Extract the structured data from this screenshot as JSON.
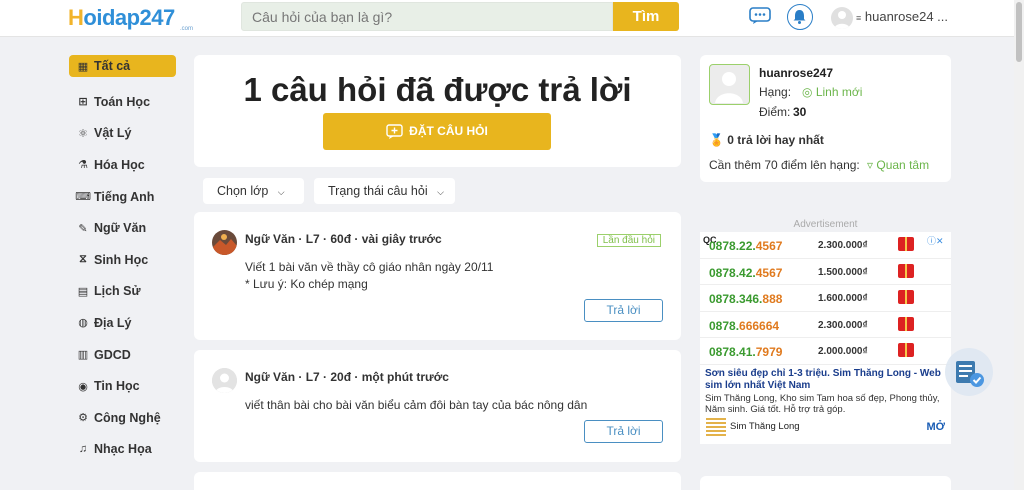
{
  "header": {
    "logo_h": "H",
    "logo_rest": "oidap247",
    "logo_sub": ".com",
    "search_placeholder": "Câu hỏi của bạn là gì?",
    "search_button": "Tìm",
    "user_name": "huanrose24 ..."
  },
  "sidebar": {
    "items": [
      {
        "label": "Tất cả",
        "icon": "grid-icon",
        "glyph": "▦"
      },
      {
        "label": "Toán Học",
        "icon": "calculator-icon",
        "glyph": "⊞"
      },
      {
        "label": "Vật Lý",
        "icon": "atom-icon",
        "glyph": "⚛"
      },
      {
        "label": "Hóa Học",
        "icon": "flask-icon",
        "glyph": "⚗"
      },
      {
        "label": "Tiếng Anh",
        "icon": "language-icon",
        "glyph": "⌨"
      },
      {
        "label": "Ngữ Văn",
        "icon": "pen-icon",
        "glyph": "✎"
      },
      {
        "label": "Sinh Học",
        "icon": "dna-icon",
        "glyph": "⧖"
      },
      {
        "label": "Lịch Sử",
        "icon": "scroll-icon",
        "glyph": "▤"
      },
      {
        "label": "Địa Lý",
        "icon": "globe-icon",
        "glyph": "◍"
      },
      {
        "label": "GDCD",
        "icon": "book-icon",
        "glyph": "▥"
      },
      {
        "label": "Tin Học",
        "icon": "computer-icon",
        "glyph": "◉"
      },
      {
        "label": "Công Nghệ",
        "icon": "gear-icon",
        "glyph": "⚙"
      },
      {
        "label": "Nhạc Họa",
        "icon": "music-icon",
        "glyph": "♫"
      }
    ]
  },
  "hero": {
    "title": "1 câu hỏi đã được trả lời",
    "ask_button": "ĐẶT CÂU HỎI"
  },
  "filters": {
    "grade": "Chọn lớp",
    "status": "Trạng thái câu hỏi"
  },
  "questions": [
    {
      "meta": "Ngữ Văn  ·  L7  ·  60đ  ·  vài giây trước",
      "tag": "Lần đầu hỏi",
      "line1": "Viết 1 bài văn về thầy cô giáo nhân ngày 20/11",
      "line2": "* Lưu ý: Ko chép mạng",
      "answer": "Trả lời"
    },
    {
      "meta": "Ngữ Văn  ·  L7  ·  20đ  ·  một phút trước",
      "line1": "viết thân bài cho bài văn biểu cảm đôi bàn tay của bác nông dân",
      "answer": "Trả lời"
    }
  ],
  "profile": {
    "name": "huanrose247",
    "rank_label": "Hạng:",
    "rank_value": "Linh mới",
    "points_label": "Điểm:",
    "points_value": "30",
    "best": "0 trả lời hay nhất",
    "need": "Cần thêm 70 điểm lên hạng:",
    "follow": "Quan tâm"
  },
  "ad": {
    "label": "Advertisement",
    "qc": "QC",
    "rows": [
      {
        "num_a": "0878.22.",
        "num_b": "4567",
        "price": "2.300.000₫"
      },
      {
        "num_a": "0878.42.",
        "num_b": "4567",
        "price": "1.500.000₫"
      },
      {
        "num_a": "0878.346.",
        "num_b": "888",
        "price": "1.600.000₫"
      },
      {
        "num_a": "0878.",
        "num_b": "666664",
        "price": "2.300.000₫"
      },
      {
        "num_a": "0878.41.",
        "num_b": "7979",
        "price": "2.000.000₫"
      }
    ],
    "title": "Sơn siêu đẹp chỉ 1-3 triệu. Sim Thăng Long - Web sim lớn nhất Việt Nam",
    "desc": "Sim Thăng Long, Kho sim Tam hoa số đẹp, Phong thủy, Năm sinh. Giá tốt. Hỗ trợ trả góp.",
    "brand": "Sim Thăng Long",
    "more": "MỞ"
  }
}
